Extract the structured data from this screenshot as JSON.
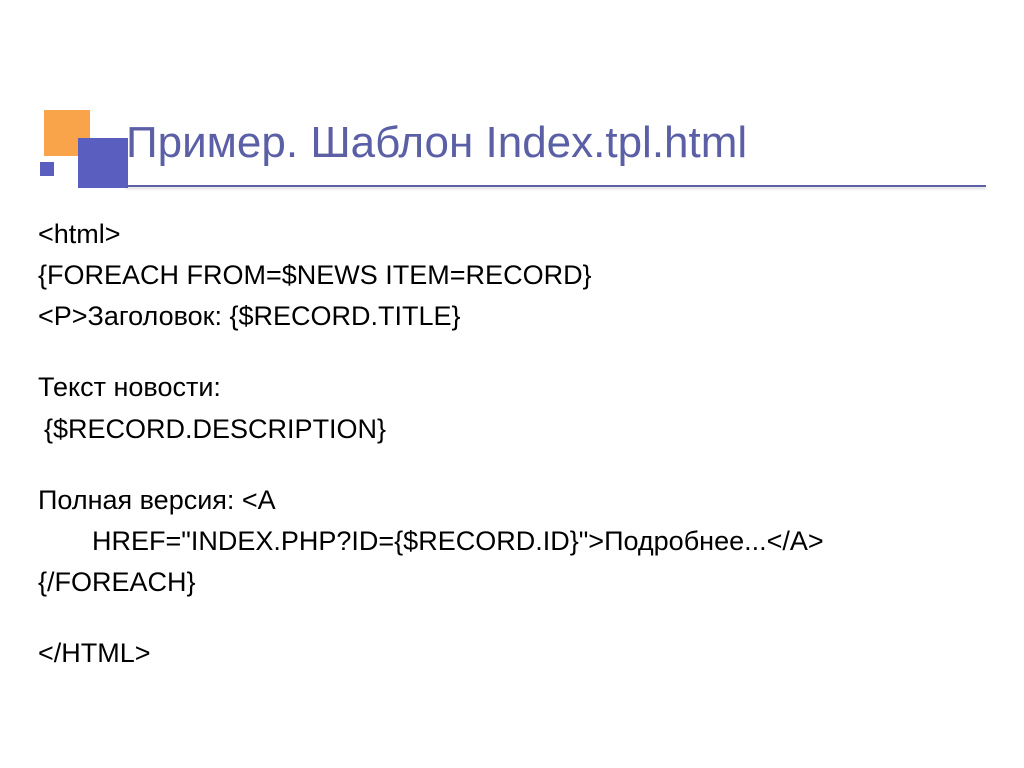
{
  "title": "Пример. Шаблон Index.tpl.html",
  "lines": {
    "l1": "<html>",
    "l2": "{FOREACH FROM=$NEWS ITEM=RECORD}",
    "l3": "<P>Заголовок: {$RECORD.TITLE}",
    "l4": "Текст новости:",
    "l5": " {$RECORD.DESCRIPTION}",
    "l6a": "Полная версия: <A ",
    "l6b": "HREF=\"INDEX.PHP?ID={$RECORD.ID}\">Подробнее...</A>",
    "l7": "{/FOREACH}",
    "l8": "</HTML>"
  }
}
